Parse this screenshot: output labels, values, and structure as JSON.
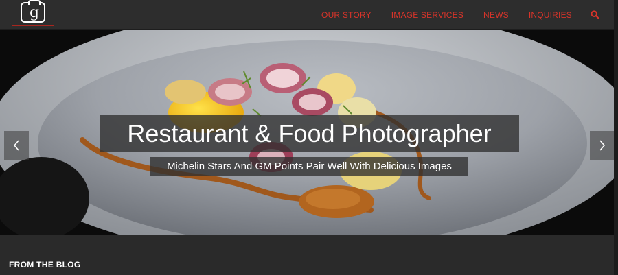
{
  "header": {
    "logo_glyph": "g",
    "nav": [
      "OUR STORY",
      "IMAGE SERVICES",
      "NEWS",
      "INQUIRIES"
    ],
    "search_icon": "search-icon"
  },
  "colors": {
    "header_bg": "#2d2d2d",
    "nav_text": "#d8342a",
    "page_bg": "#2a2a2a",
    "caption_bg": "#303030"
  },
  "hero": {
    "headline": "Restaurant & Food Photographer",
    "subheadline": "Michelin Stars And GM Points Pair Well With Delicious Images",
    "prev_icon": "chevron-left-icon",
    "next_icon": "chevron-right-icon"
  },
  "blog": {
    "heading": "FROM THE BLOG"
  }
}
